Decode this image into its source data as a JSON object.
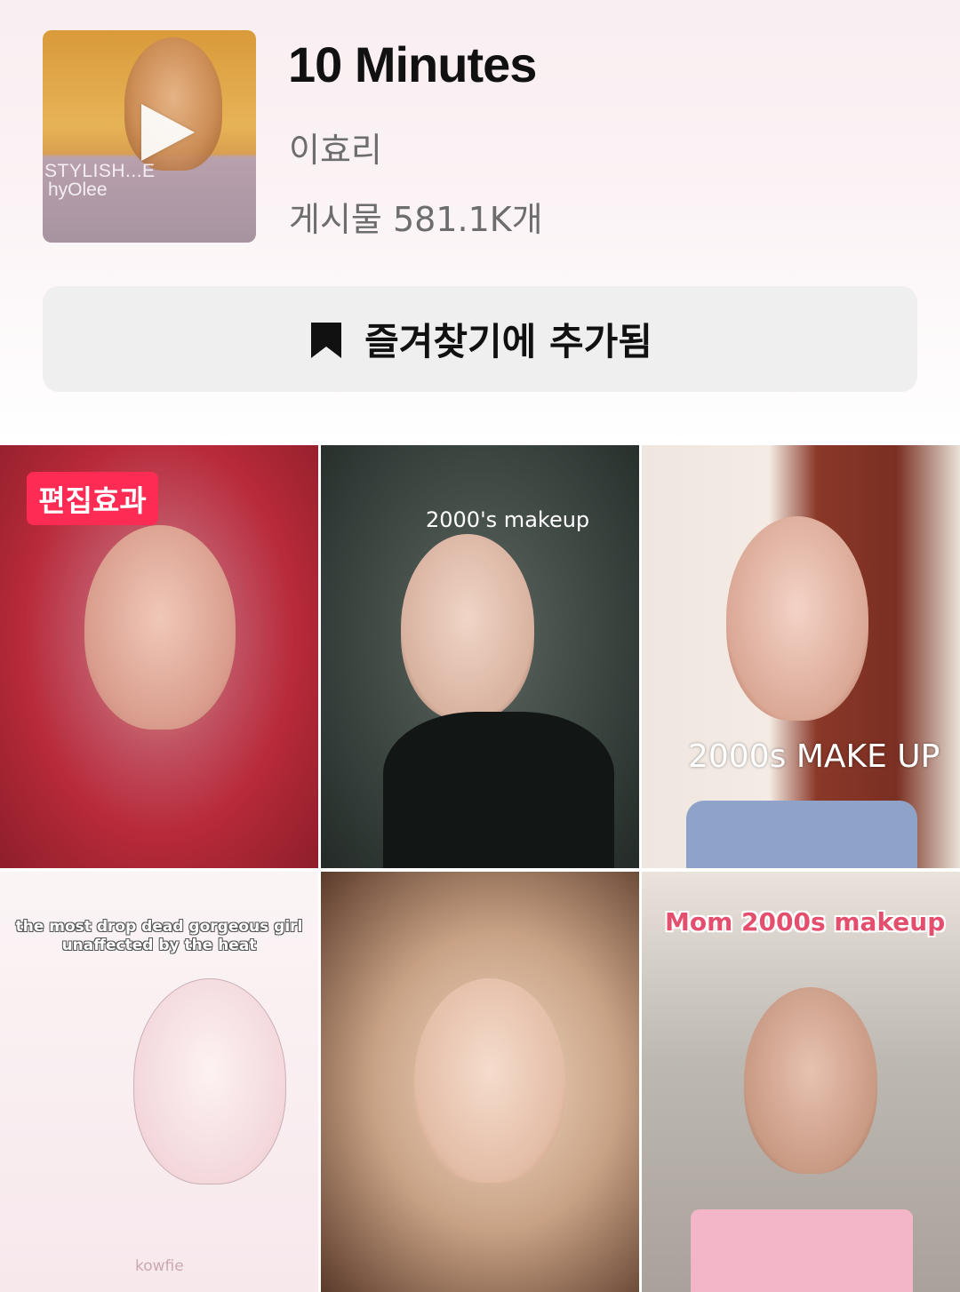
{
  "sound": {
    "title": "10 Minutes",
    "artist": "이효리",
    "posts": "게시물 581.1K개",
    "album": {
      "line1": "STYLISH...E",
      "line2": "hyOlee"
    }
  },
  "favorite_button": {
    "label": "즐겨찾기에 추가됨",
    "icon": "bookmark-icon"
  },
  "videos": [
    {
      "badge": "편집효과",
      "caption": ""
    },
    {
      "caption": "2000's makeup"
    },
    {
      "caption": "2000s MAKE UP"
    },
    {
      "caption": "the most drop dead gorgeous girl unaffected by the heat",
      "watermark": "kowfie"
    },
    {
      "caption": ""
    },
    {
      "caption": "Mom 2000s makeup"
    }
  ],
  "colors": {
    "badge": "#fe2c55",
    "button_bg": "#efefef",
    "title": "#111111",
    "meta": "#6d6d6d"
  }
}
